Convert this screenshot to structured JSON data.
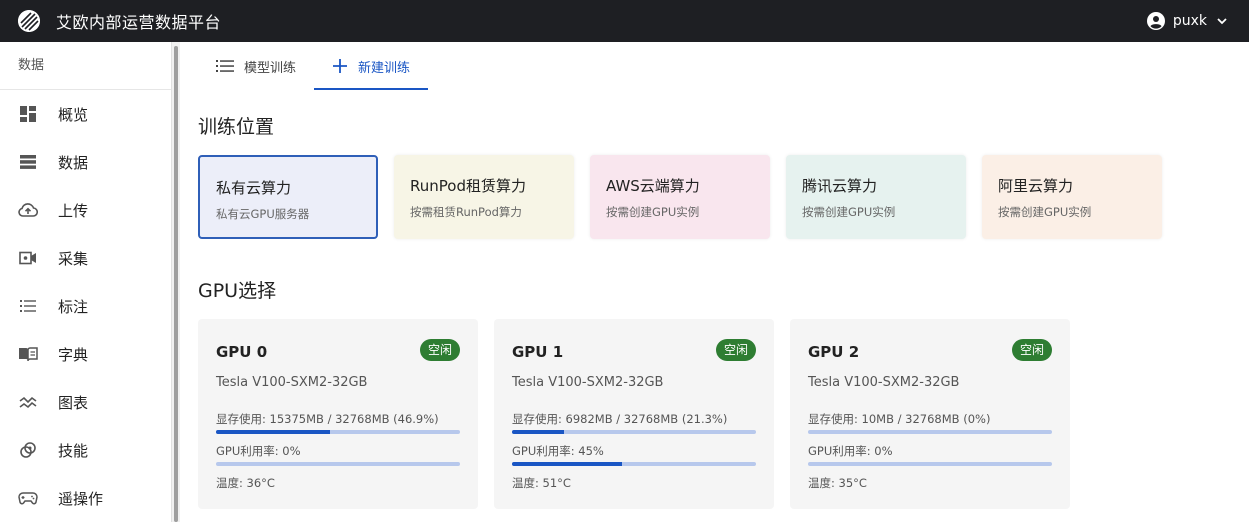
{
  "header": {
    "title": "艾欧内部运营数据平台",
    "username": "puxk"
  },
  "sidebar": {
    "section": "数据",
    "items": [
      {
        "label": "概览",
        "icon": "dashboard-icon"
      },
      {
        "label": "数据",
        "icon": "storage-icon"
      },
      {
        "label": "上传",
        "icon": "cloud-upload-icon"
      },
      {
        "label": "采集",
        "icon": "video-camera-icon"
      },
      {
        "label": "标注",
        "icon": "list-numbered-icon"
      },
      {
        "label": "字典",
        "icon": "book-icon"
      },
      {
        "label": "图表",
        "icon": "chart-line-icon"
      },
      {
        "label": "技能",
        "icon": "skill-icon"
      },
      {
        "label": "遥操作",
        "icon": "gamepad-icon"
      }
    ]
  },
  "tabs": [
    {
      "label": "模型训练",
      "icon": "list-icon",
      "active": false
    },
    {
      "label": "新建训练",
      "icon": "plus-icon",
      "active": true
    }
  ],
  "training_location": {
    "title": "训练位置",
    "options": [
      {
        "title": "私有云算力",
        "subtitle": "私有云GPU服务器",
        "selected": true,
        "bg": "#eceef9"
      },
      {
        "title": "RunPod租赁算力",
        "subtitle": "按需租赁RunPod算力",
        "selected": false,
        "bg": "#f7f5e6"
      },
      {
        "title": "AWS云端算力",
        "subtitle": "按需创建GPU实例",
        "selected": false,
        "bg": "#f9e6ee"
      },
      {
        "title": "腾讯云算力",
        "subtitle": "按需创建GPU实例",
        "selected": false,
        "bg": "#e6f2ef"
      },
      {
        "title": "阿里云算力",
        "subtitle": "按需创建GPU实例",
        "selected": false,
        "bg": "#fbefe6"
      }
    ]
  },
  "gpu_selection": {
    "title": "GPU选择",
    "gpus": [
      {
        "name": "GPU 0",
        "status": "空闲",
        "model": "Tesla V100-SXM2-32GB",
        "memory_text": "显存使用: 15375MB / 32768MB (46.9%)",
        "memory_pct": 46.9,
        "util_text": "GPU利用率: 0%",
        "util_pct": 0,
        "temp_text": "温度: 36°C"
      },
      {
        "name": "GPU 1",
        "status": "空闲",
        "model": "Tesla V100-SXM2-32GB",
        "memory_text": "显存使用: 6982MB / 32768MB (21.3%)",
        "memory_pct": 21.3,
        "util_text": "GPU利用率: 45%",
        "util_pct": 45,
        "temp_text": "温度: 51°C"
      },
      {
        "name": "GPU 2",
        "status": "空闲",
        "model": "Tesla V100-SXM2-32GB",
        "memory_text": "显存使用: 10MB / 32768MB (0%)",
        "memory_pct": 0,
        "util_text": "GPU利用率: 0%",
        "util_pct": 0,
        "temp_text": "温度: 35°C"
      }
    ]
  },
  "colors": {
    "accent": "#1a56c4",
    "badge_green": "#2e7d32",
    "topbar": "#1e1f23"
  }
}
